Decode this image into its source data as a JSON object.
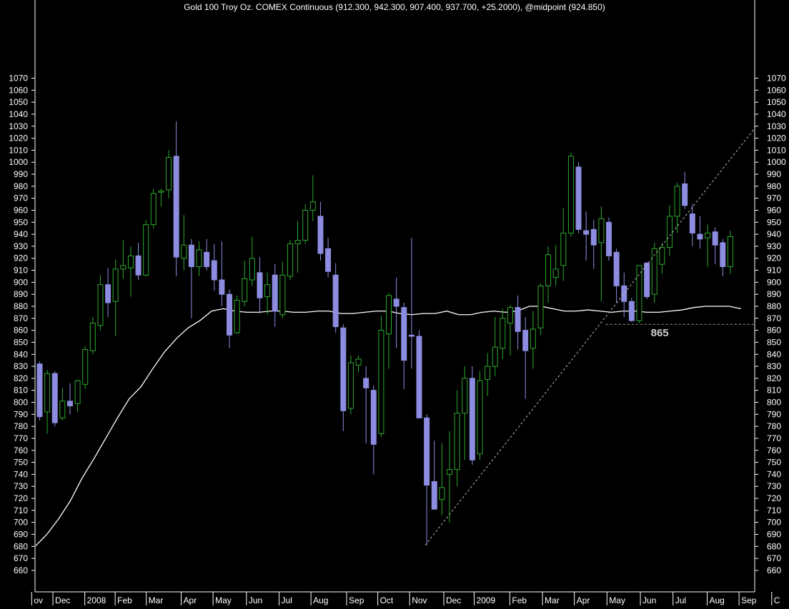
{
  "colors": {
    "background": "#000000",
    "axis": "#ffffff",
    "tick_text": "#ffffff",
    "down_candle_fill": "#8c8ce0",
    "down_candle_wick": "#8c8ce0",
    "up_candle_stroke": "#2ea82e",
    "moving_average": "#ffffff",
    "trendline": "#bbbbbb",
    "support_line": "#9a9a9a",
    "annotation": "#cfcfcf"
  },
  "chart_data": {
    "type": "candlestick",
    "title": "Gold 100 Troy Oz. COMEX Continuous (912.300, 942.300, 907.400, 937.700, +25.2000), @midpoint (924.850)",
    "ylim": [
      650,
      1073
    ],
    "y_ticks": [
      660,
      670,
      680,
      690,
      700,
      710,
      720,
      730,
      740,
      750,
      760,
      770,
      780,
      790,
      800,
      810,
      820,
      830,
      840,
      850,
      860,
      870,
      880,
      890,
      900,
      910,
      920,
      930,
      940,
      950,
      960,
      970,
      980,
      990,
      1000,
      1010,
      1020,
      1030,
      1040,
      1050,
      1060,
      1070
    ],
    "x_ticks": [
      {
        "label": "ov",
        "i": -0.3
      },
      {
        "label": "Dec",
        "i": 2.5
      },
      {
        "label": "2008",
        "i": 6.7
      },
      {
        "label": "Feb",
        "i": 10.7
      },
      {
        "label": "Mar",
        "i": 14.8
      },
      {
        "label": "Apr",
        "i": 19.4
      },
      {
        "label": "May",
        "i": 23.6
      },
      {
        "label": "Jun",
        "i": 28.0
      },
      {
        "label": "Jul",
        "i": 32.3
      },
      {
        "label": "Aug",
        "i": 36.5
      },
      {
        "label": "Sep",
        "i": 41.2
      },
      {
        "label": "Oct",
        "i": 45.3
      },
      {
        "label": "Nov",
        "i": 49.5
      },
      {
        "label": "Dec",
        "i": 54.0
      },
      {
        "label": "2009",
        "i": 58.0
      },
      {
        "label": "Feb",
        "i": 62.7
      },
      {
        "label": "Mar",
        "i": 67.0
      },
      {
        "label": "Apr",
        "i": 71.2
      },
      {
        "label": "May",
        "i": 75.5
      },
      {
        "label": "Jun",
        "i": 79.9
      },
      {
        "label": "Jul",
        "i": 84.2
      },
      {
        "label": "Aug",
        "i": 88.7
      },
      {
        "label": "Sep",
        "i": 92.9
      },
      {
        "label": "C",
        "i": 97.2
      }
    ],
    "candles": [
      {
        "o": 832,
        "h": 834,
        "l": 785,
        "c": 788
      },
      {
        "o": 792,
        "h": 827,
        "l": 774,
        "c": 824
      },
      {
        "o": 824,
        "h": 826,
        "l": 780,
        "c": 783
      },
      {
        "o": 787,
        "h": 812,
        "l": 785,
        "c": 801
      },
      {
        "o": 801,
        "h": 816,
        "l": 790,
        "c": 797
      },
      {
        "o": 799,
        "h": 819,
        "l": 792,
        "c": 818
      },
      {
        "o": 815,
        "h": 847,
        "l": 811,
        "c": 844
      },
      {
        "o": 843,
        "h": 871,
        "l": 840,
        "c": 866
      },
      {
        "o": 864,
        "h": 906,
        "l": 860,
        "c": 898
      },
      {
        "o": 898,
        "h": 912,
        "l": 871,
        "c": 883
      },
      {
        "o": 884,
        "h": 919,
        "l": 855,
        "c": 911
      },
      {
        "o": 911,
        "h": 935,
        "l": 903,
        "c": 914
      },
      {
        "o": 912,
        "h": 930,
        "l": 888,
        "c": 922
      },
      {
        "o": 922,
        "h": 933,
        "l": 902,
        "c": 906
      },
      {
        "o": 906,
        "h": 952,
        "l": 905,
        "c": 948
      },
      {
        "o": 948,
        "h": 978,
        "l": 945,
        "c": 974
      },
      {
        "o": 975,
        "h": 978,
        "l": 963,
        "c": 976
      },
      {
        "o": 977,
        "h": 1010,
        "l": 970,
        "c": 1004
      },
      {
        "o": 1005,
        "h": 1034,
        "l": 905,
        "c": 921
      },
      {
        "o": 920,
        "h": 956,
        "l": 910,
        "c": 931
      },
      {
        "o": 931,
        "h": 936,
        "l": 870,
        "c": 913
      },
      {
        "o": 913,
        "h": 934,
        "l": 905,
        "c": 927
      },
      {
        "o": 925,
        "h": 936,
        "l": 910,
        "c": 913
      },
      {
        "o": 918,
        "h": 932,
        "l": 893,
        "c": 902
      },
      {
        "o": 902,
        "h": 934,
        "l": 880,
        "c": 890
      },
      {
        "o": 890,
        "h": 894,
        "l": 845,
        "c": 856
      },
      {
        "o": 858,
        "h": 889,
        "l": 857,
        "c": 885
      },
      {
        "o": 884,
        "h": 918,
        "l": 880,
        "c": 903
      },
      {
        "o": 902,
        "h": 938,
        "l": 897,
        "c": 920
      },
      {
        "o": 908,
        "h": 921,
        "l": 874,
        "c": 887
      },
      {
        "o": 888,
        "h": 908,
        "l": 873,
        "c": 898
      },
      {
        "o": 906,
        "h": 915,
        "l": 863,
        "c": 876
      },
      {
        "o": 873,
        "h": 917,
        "l": 870,
        "c": 906
      },
      {
        "o": 905,
        "h": 935,
        "l": 902,
        "c": 932
      },
      {
        "o": 932,
        "h": 951,
        "l": 908,
        "c": 935
      },
      {
        "o": 935,
        "h": 965,
        "l": 932,
        "c": 960
      },
      {
        "o": 960,
        "h": 989,
        "l": 951,
        "c": 967
      },
      {
        "o": 955,
        "h": 967,
        "l": 918,
        "c": 924
      },
      {
        "o": 928,
        "h": 937,
        "l": 904,
        "c": 909
      },
      {
        "o": 906,
        "h": 916,
        "l": 858,
        "c": 863
      },
      {
        "o": 862,
        "h": 865,
        "l": 776,
        "c": 793
      },
      {
        "o": 795,
        "h": 839,
        "l": 790,
        "c": 833
      },
      {
        "o": 831,
        "h": 839,
        "l": 825,
        "c": 836
      },
      {
        "o": 820,
        "h": 830,
        "l": 766,
        "c": 812
      },
      {
        "o": 810,
        "h": 814,
        "l": 740,
        "c": 765
      },
      {
        "o": 774,
        "h": 872,
        "l": 771,
        "c": 860
      },
      {
        "o": 857,
        "h": 891,
        "l": 828,
        "c": 889
      },
      {
        "o": 886,
        "h": 904,
        "l": 845,
        "c": 880
      },
      {
        "o": 879,
        "h": 883,
        "l": 811,
        "c": 835
      },
      {
        "o": 856,
        "h": 937,
        "l": 828,
        "c": 855
      },
      {
        "o": 855,
        "h": 860,
        "l": 788,
        "c": 787
      },
      {
        "o": 787,
        "h": 790,
        "l": 681,
        "c": 731
      },
      {
        "o": 734,
        "h": 768,
        "l": 715,
        "c": 711
      },
      {
        "o": 719,
        "h": 766,
        "l": 706,
        "c": 729
      },
      {
        "o": 740,
        "h": 776,
        "l": 700,
        "c": 744
      },
      {
        "o": 744,
        "h": 810,
        "l": 730,
        "c": 791
      },
      {
        "o": 791,
        "h": 830,
        "l": 752,
        "c": 820
      },
      {
        "o": 820,
        "h": 830,
        "l": 748,
        "c": 752
      },
      {
        "o": 757,
        "h": 826,
        "l": 752,
        "c": 818
      },
      {
        "o": 819,
        "h": 841,
        "l": 805,
        "c": 830
      },
      {
        "o": 830,
        "h": 871,
        "l": 822,
        "c": 846
      },
      {
        "o": 845,
        "h": 878,
        "l": 836,
        "c": 870
      },
      {
        "o": 866,
        "h": 881,
        "l": 839,
        "c": 879
      },
      {
        "o": 879,
        "h": 889,
        "l": 844,
        "c": 859
      },
      {
        "o": 860,
        "h": 871,
        "l": 803,
        "c": 843
      },
      {
        "o": 845,
        "h": 876,
        "l": 828,
        "c": 861
      },
      {
        "o": 862,
        "h": 899,
        "l": 856,
        "c": 897
      },
      {
        "o": 897,
        "h": 930,
        "l": 883,
        "c": 923
      },
      {
        "o": 904,
        "h": 931,
        "l": 897,
        "c": 911
      },
      {
        "o": 914,
        "h": 962,
        "l": 901,
        "c": 941
      },
      {
        "o": 941,
        "h": 1008,
        "l": 938,
        "c": 1005
      },
      {
        "o": 996,
        "h": 1000,
        "l": 941,
        "c": 944
      },
      {
        "o": 943,
        "h": 959,
        "l": 918,
        "c": 940
      },
      {
        "o": 944,
        "h": 952,
        "l": 911,
        "c": 931
      },
      {
        "o": 933,
        "h": 963,
        "l": 884,
        "c": 953
      },
      {
        "o": 950,
        "h": 954,
        "l": 918,
        "c": 922
      },
      {
        "o": 925,
        "h": 928,
        "l": 883,
        "c": 897
      },
      {
        "o": 897,
        "h": 908,
        "l": 871,
        "c": 884
      },
      {
        "o": 884,
        "h": 887,
        "l": 867,
        "c": 868
      },
      {
        "o": 868,
        "h": 913,
        "l": 866,
        "c": 914
      },
      {
        "o": 916,
        "h": 917,
        "l": 886,
        "c": 888
      },
      {
        "o": 890,
        "h": 933,
        "l": 883,
        "c": 928
      },
      {
        "o": 915,
        "h": 933,
        "l": 907,
        "c": 929
      },
      {
        "o": 929,
        "h": 964,
        "l": 922,
        "c": 955
      },
      {
        "o": 955,
        "h": 983,
        "l": 941,
        "c": 980
      },
      {
        "o": 982,
        "h": 992,
        "l": 961,
        "c": 964
      },
      {
        "o": 957,
        "h": 965,
        "l": 930,
        "c": 941
      },
      {
        "o": 940,
        "h": 955,
        "l": 928,
        "c": 936
      },
      {
        "o": 937,
        "h": 948,
        "l": 913,
        "c": 941
      },
      {
        "o": 942,
        "h": 946,
        "l": 915,
        "c": 931
      },
      {
        "o": 933,
        "h": 936,
        "l": 905,
        "c": 913
      },
      {
        "o": 913,
        "h": 943,
        "l": 907,
        "c": 938
      }
    ],
    "moving_average": [
      [
        0,
        680
      ],
      [
        2,
        690
      ],
      [
        4,
        703
      ],
      [
        6,
        718
      ],
      [
        8,
        737
      ],
      [
        10,
        753
      ],
      [
        12,
        770
      ],
      [
        14,
        787
      ],
      [
        16,
        803
      ],
      [
        18,
        813
      ],
      [
        20,
        828
      ],
      [
        22,
        842
      ],
      [
        24,
        853
      ],
      [
        26,
        862
      ],
      [
        28,
        868
      ],
      [
        30,
        876
      ],
      [
        32,
        878
      ],
      [
        34,
        876
      ],
      [
        36,
        875
      ],
      [
        38,
        875
      ],
      [
        40,
        876
      ],
      [
        42,
        876
      ],
      [
        44,
        875
      ],
      [
        46,
        875
      ],
      [
        48,
        876
      ],
      [
        50,
        876
      ],
      [
        52,
        874
      ],
      [
        54,
        874
      ],
      [
        56,
        875
      ],
      [
        58,
        876
      ],
      [
        60,
        876
      ],
      [
        62,
        874
      ],
      [
        64,
        873
      ],
      [
        66,
        874
      ],
      [
        68,
        874
      ],
      [
        70,
        876
      ],
      [
        72,
        873
      ],
      [
        74,
        873
      ],
      [
        76,
        875
      ],
      [
        78,
        876
      ],
      [
        80,
        875
      ],
      [
        82,
        876
      ],
      [
        84,
        880
      ],
      [
        86,
        880
      ],
      [
        88,
        878
      ],
      [
        90,
        876
      ],
      [
        92,
        876
      ],
      [
        94,
        877
      ],
      [
        96,
        876
      ],
      [
        98,
        875
      ],
      [
        100,
        876
      ],
      [
        102,
        876
      ],
      [
        104,
        875
      ],
      [
        106,
        875
      ],
      [
        108,
        876
      ],
      [
        110,
        877
      ],
      [
        112,
        879
      ],
      [
        114,
        880
      ],
      [
        116,
        880
      ],
      [
        118,
        880
      ],
      [
        120,
        878
      ]
    ],
    "trendline": {
      "from": {
        "i": 50.8,
        "v": 681
      },
      "to": {
        "i": 99.8,
        "v": 1073
      },
      "style": "dashed"
    },
    "support_line": {
      "from_i": 74.6,
      "value": 865,
      "style": "dashed"
    },
    "annotation": {
      "text": "865",
      "i": 81.7,
      "v": 855
    }
  }
}
